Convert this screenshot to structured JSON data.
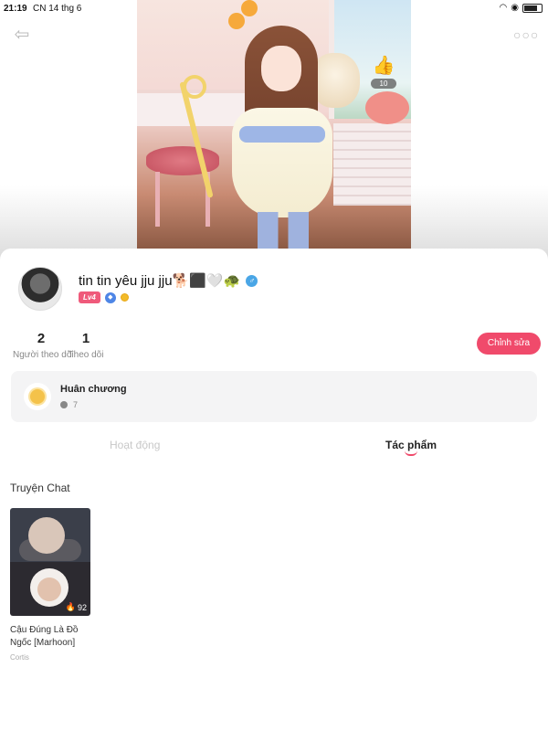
{
  "status_bar": {
    "time": "21:19",
    "date": "CN 14 thg 6"
  },
  "hero": {
    "likes": "10"
  },
  "profile": {
    "username": "tin tin yêu jju jju🐕‍⬛🤍🐢",
    "gender_symbol": "♂",
    "level": "Lv4"
  },
  "stats": {
    "followers_count": "2",
    "followers_label": "Người theo dõi",
    "following_count": "1",
    "following_label": "Theo dõi"
  },
  "edit_button_label": "Chỉnh sửa",
  "medal": {
    "title": "Huân chương",
    "count": "7"
  },
  "tabs": {
    "activity": "Hoạt động",
    "works": "Tác phẩm"
  },
  "section": {
    "title": "Truyện Chat"
  },
  "works": [
    {
      "title": "Cậu Đúng Là Đồ Ngốc [Marhoon]",
      "author": "Cortis",
      "views": "92"
    }
  ],
  "colors": {
    "accent": "#f04a6b",
    "like": "#ee3a4b"
  }
}
